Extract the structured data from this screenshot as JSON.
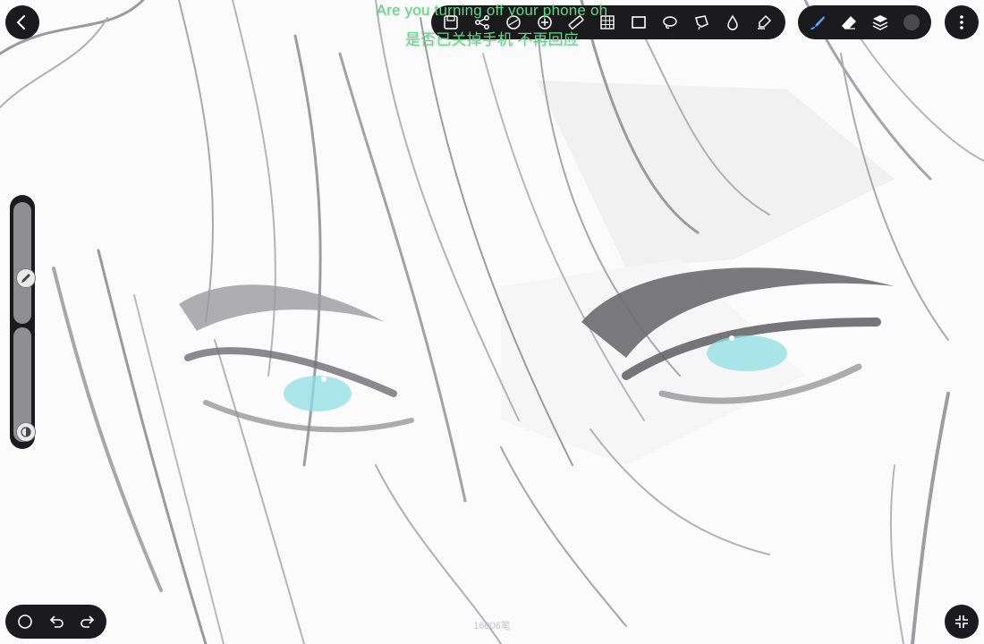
{
  "subtitles": {
    "line1": "Are you turning off your phone oh",
    "line2": "是否已关掉手机 不再回应"
  },
  "canvas": {
    "stroke_count": "16006笔",
    "eye_color": "#8fdde3",
    "stroke_color": "#7a7a7c"
  },
  "toolbar": {
    "tools": [
      {
        "icon": "save-icon"
      },
      {
        "icon": "share-icon"
      },
      {
        "icon": "adjust-icon"
      },
      {
        "icon": "add-icon"
      },
      {
        "icon": "ruler-icon"
      },
      {
        "icon": "grid-icon"
      },
      {
        "icon": "rect-select-icon"
      },
      {
        "icon": "lasso-icon"
      },
      {
        "icon": "polygon-lasso-icon"
      },
      {
        "icon": "fill-drop-icon"
      },
      {
        "icon": "smudge-icon"
      }
    ],
    "brush_tools": [
      {
        "icon": "brush-icon",
        "active": true,
        "color": "#5aa6ff"
      },
      {
        "icon": "eraser-icon"
      },
      {
        "icon": "layers-icon"
      },
      {
        "icon": "color-swatch",
        "color": "#4a4a4c"
      }
    ]
  },
  "sidebar": {
    "brush_size_level": 0.36,
    "opacity_level": 0.0
  }
}
